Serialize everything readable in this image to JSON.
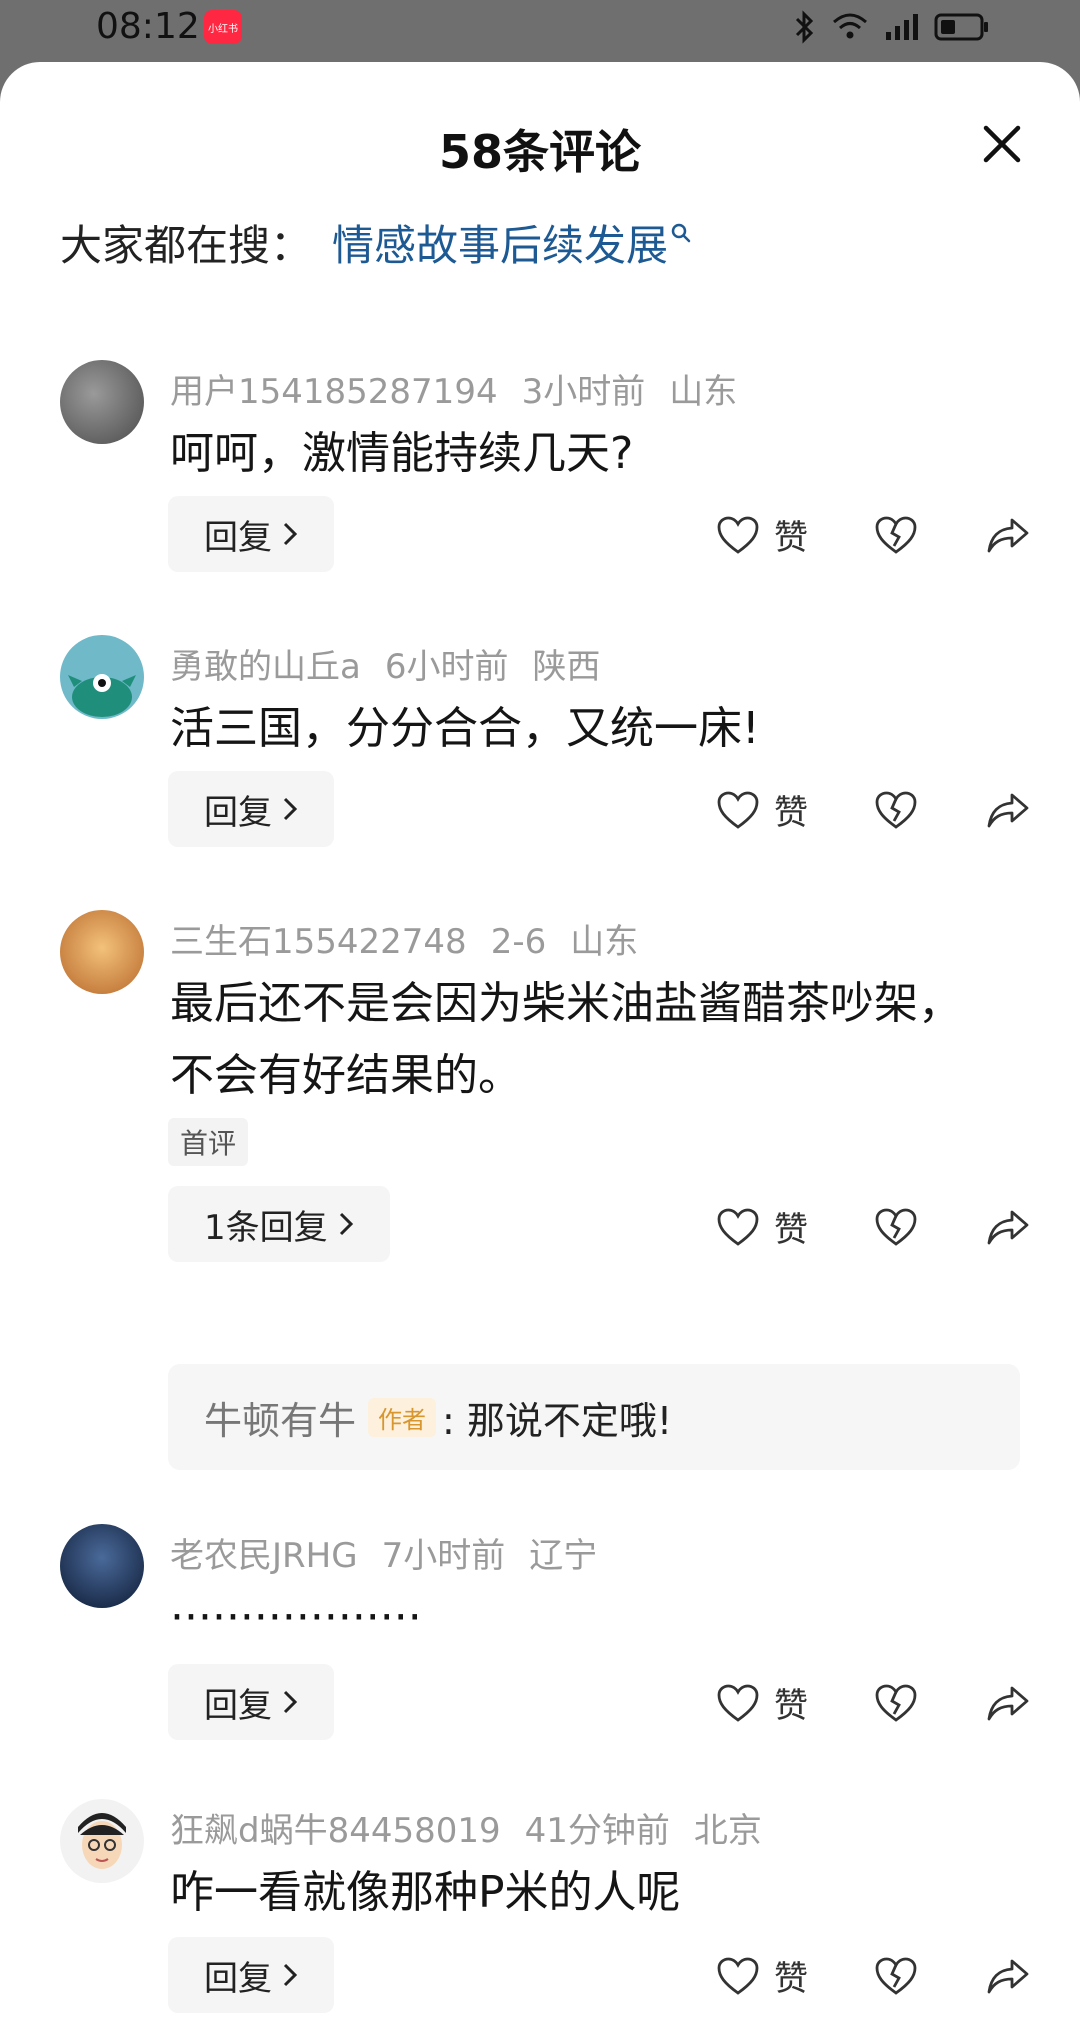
{
  "status": {
    "time": "08:12",
    "app_badge": "小红书"
  },
  "sheet": {
    "title": "58条评论",
    "search_prefix": "大家都在搜：",
    "search_link": "情感故事后续发展"
  },
  "actions": {
    "like": "赞"
  },
  "comments": [
    {
      "user": "用户154185287194",
      "time": "3小时前",
      "location": "山东",
      "text": "呵呵，激情能持续几天?",
      "reply": "回复"
    },
    {
      "user": "勇敢的山丘a",
      "time": "6小时前",
      "location": "陕西",
      "text": "活三国，分分合合，又统一床!",
      "reply": "回复"
    },
    {
      "user": "三生石155422748",
      "time": "2-6",
      "location": "山东",
      "text": "最后还不是会因为柴米油盐酱醋茶吵架，不会有好结果的。",
      "tag": "首评",
      "reply": "1条回复",
      "sub": {
        "name": "牛顿有牛",
        "badge": "作者",
        "text": ": 那说不定哦!"
      }
    },
    {
      "user": "老农民JRHG",
      "time": "7小时前",
      "location": "辽宁",
      "text": "··················",
      "reply": "回复"
    },
    {
      "user": "狂飙d蜗牛84458019",
      "time": "41分钟前",
      "location": "北京",
      "text": "咋一看就像那种P米的人呢",
      "reply": "回复"
    }
  ]
}
